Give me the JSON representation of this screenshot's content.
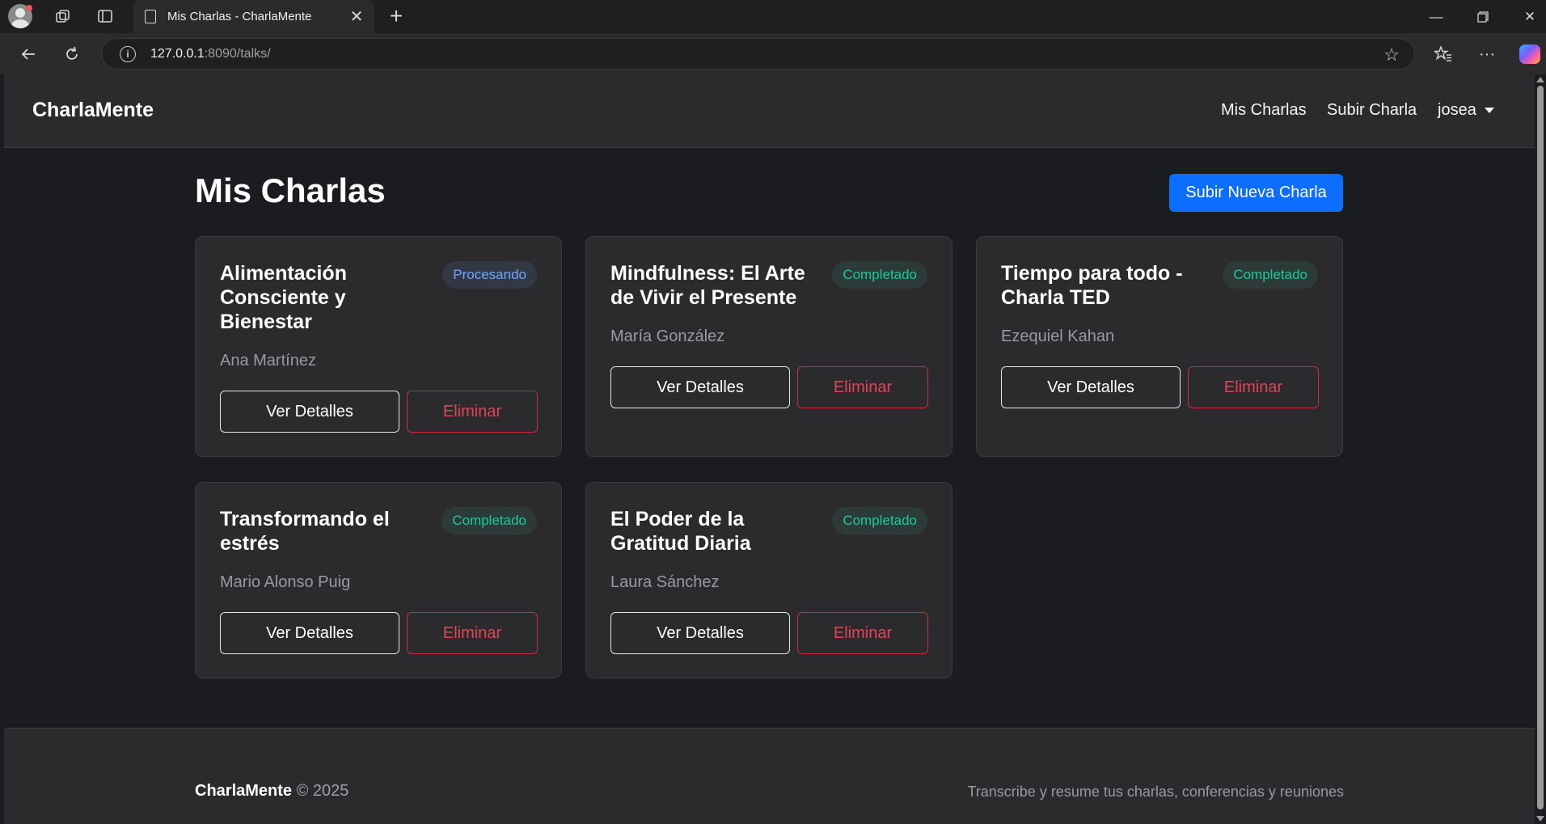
{
  "browser": {
    "tab_title": "Mis Charlas - CharlaMente",
    "url_host": "127.0.0.1",
    "url_rest": ":8090/talks/"
  },
  "site": {
    "brand": "CharlaMente",
    "nav": {
      "my_talks": "Mis Charlas",
      "upload_talk": "Subir Charla",
      "user": "josea"
    }
  },
  "main": {
    "title": "Mis Charlas",
    "upload_new_button": "Subir Nueva Charla",
    "view_details_label": "Ver Detalles",
    "delete_label": "Eliminar",
    "talks": [
      {
        "title": "Alimentación Consciente y Bienestar",
        "status": "Procesando",
        "author": "Ana Martínez",
        "details": "Ver Detalles",
        "delete": "Eliminar"
      },
      {
        "title": "Mindfulness: El Arte de Vivir el Presente",
        "status": "Completado",
        "author": "María González",
        "details": "Ver Detalles",
        "delete": "Eliminar"
      },
      {
        "title": "Tiempo para todo - Charla TED",
        "status": "Completado",
        "author": "Ezequiel Kahan",
        "details": "Ver Detalles",
        "delete": "Eliminar"
      },
      {
        "title": "Transformando el estrés",
        "status": "Completado",
        "author": "Mario Alonso Puig",
        "details": "Ver Detalles",
        "delete": "Eliminar"
      },
      {
        "title": "El Poder de la Gratitud Diaria",
        "status": "Completado",
        "author": "Laura Sánchez",
        "details": "Ver Detalles",
        "delete": "Eliminar"
      }
    ]
  },
  "footer": {
    "brand": "CharlaMente",
    "copyright": "© 2025",
    "tagline": "Transcribe y resume tus charlas, conferencias y reuniones"
  },
  "colors": {
    "primary": "#0d6efd",
    "processing": "#6ea8fe",
    "completed": "#20c997",
    "danger": "#dc3545",
    "background": "#1b1c1f",
    "surface": "#2b2b2e"
  }
}
